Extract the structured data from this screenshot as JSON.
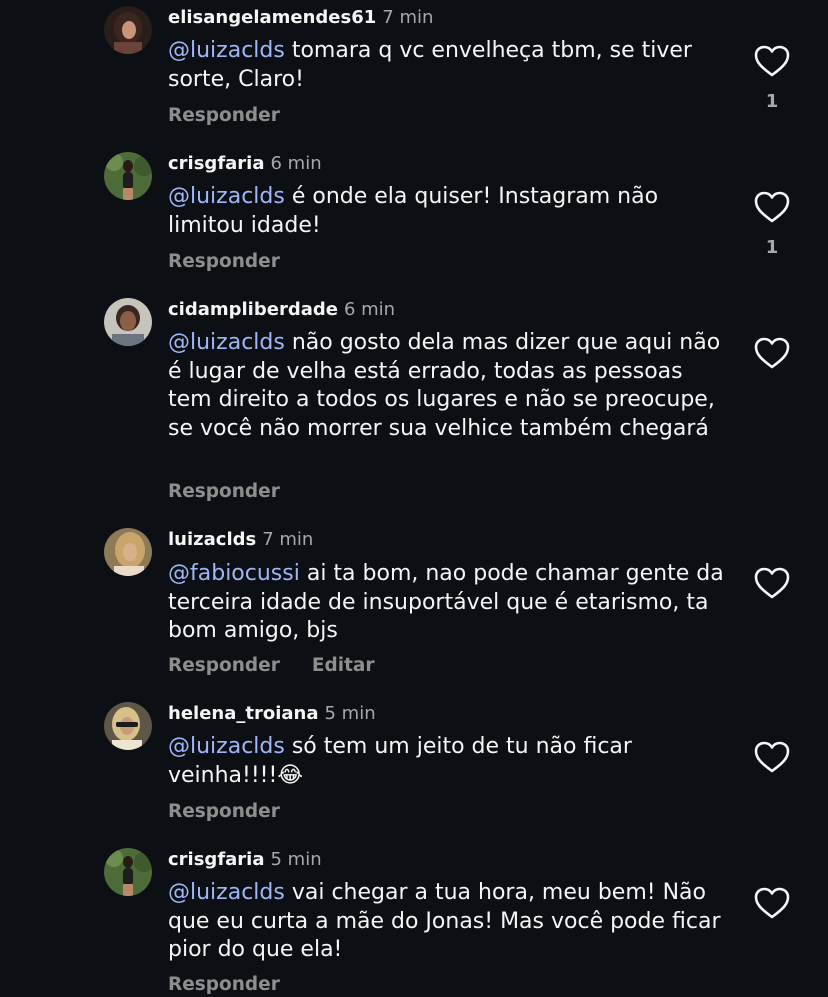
{
  "colors": {
    "background": "#0c1014",
    "text": "#f5f5f5",
    "mention": "#a0b6f7",
    "secondary": "#8e8e8e"
  },
  "comments": [
    {
      "username": "elisangelamendes61",
      "time": "7 min",
      "mention": "@luizaclds",
      "text": " tomara q vc envelheça tbm, se tiver sorte, Claro!",
      "reply": "Responder",
      "likes": "1"
    },
    {
      "username": "crisgfaria",
      "time": "6 min",
      "mention": "@luizaclds",
      "text": " é onde ela quiser! Instagram não limitou idade!",
      "reply": "Responder",
      "likes": "1"
    },
    {
      "username": "cidampliberdade",
      "time": "6 min",
      "mention": "@luizaclds",
      "text": " não gosto dela mas dizer que aqui não é lugar de velha está errado, todas as pessoas tem direito a todos os lugares e não se preocupe, se você não morrer sua velhice também chegará",
      "reply": "Responder"
    },
    {
      "username": "luizaclds",
      "time": "7 min",
      "mention": "@fabiocussi",
      "text": " ai ta bom, nao pode chamar gente da terceira idade de insuportável que é etarismo, ta bom amigo, bjs",
      "reply": "Responder",
      "edit": "Editar"
    },
    {
      "username": "helena_troiana",
      "time": "5 min",
      "mention": "@luizaclds",
      "text": " só tem um jeito de tu não ficar veinha!!!!😂",
      "reply": "Responder"
    },
    {
      "username": "crisgfaria",
      "time": "5 min",
      "mention": "@luizaclds",
      "text": " vai chegar a tua hora, meu bem! Não que eu curta a mãe do Jonas! Mas você pode ficar pior do que ela!",
      "reply": "Responder"
    }
  ]
}
